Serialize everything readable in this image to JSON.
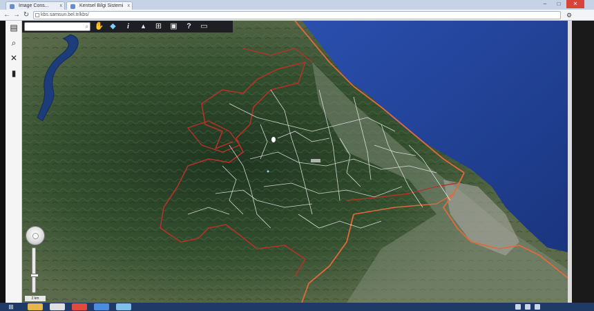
{
  "browser": {
    "tabs": [
      {
        "label": "Image Cons...",
        "active": false
      },
      {
        "label": "Kentsel Bilgi Sistemi",
        "active": true
      }
    ],
    "address": "kbs.samsun.bel.tr/kbs/",
    "window_controls": {
      "minimize": "–",
      "maximize": "□",
      "close": "✕"
    }
  },
  "left_rail": {
    "buttons": [
      {
        "icon": "layers-icon",
        "glyph": "▤"
      },
      {
        "icon": "search-icon",
        "glyph": "⌕"
      },
      {
        "icon": "tools-icon",
        "glyph": "✕"
      },
      {
        "icon": "bookmark-icon",
        "glyph": "▮"
      }
    ]
  },
  "map_toolbar": {
    "search_value": "",
    "tools": [
      {
        "icon": "pan-hand-icon",
        "glyph": "✋"
      },
      {
        "icon": "navigate-icon",
        "glyph": "◆"
      },
      {
        "icon": "info-icon",
        "glyph": "i"
      },
      {
        "icon": "trash-icon",
        "glyph": "▴"
      },
      {
        "icon": "grid-icon",
        "glyph": "⊞"
      },
      {
        "icon": "export-icon",
        "glyph": "▣"
      },
      {
        "icon": "help-icon",
        "glyph": "?"
      },
      {
        "icon": "print-icon",
        "glyph": "▭"
      }
    ]
  },
  "map": {
    "basemap": "satellite",
    "colors": {
      "sea": "#1f3f9a",
      "land": "#3b5134",
      "district_boundary": "#e06a3a",
      "admin_boundary": "#b53228",
      "roads": "#f2f2f2"
    },
    "zoom_level": 0.4,
    "scale_text": "2 km"
  },
  "taskbar": {
    "start_glyph": "⊞",
    "apps": [
      {
        "icon": "explorer-icon",
        "color": "#e7b54a"
      },
      {
        "icon": "media-icon",
        "color": "#e0e0e0"
      },
      {
        "icon": "chrome-icon",
        "color": "#e24b3b"
      },
      {
        "icon": "app-icon",
        "color": "#4a8de0"
      },
      {
        "icon": "viewer-icon",
        "color": "#7ec0e8"
      }
    ]
  }
}
